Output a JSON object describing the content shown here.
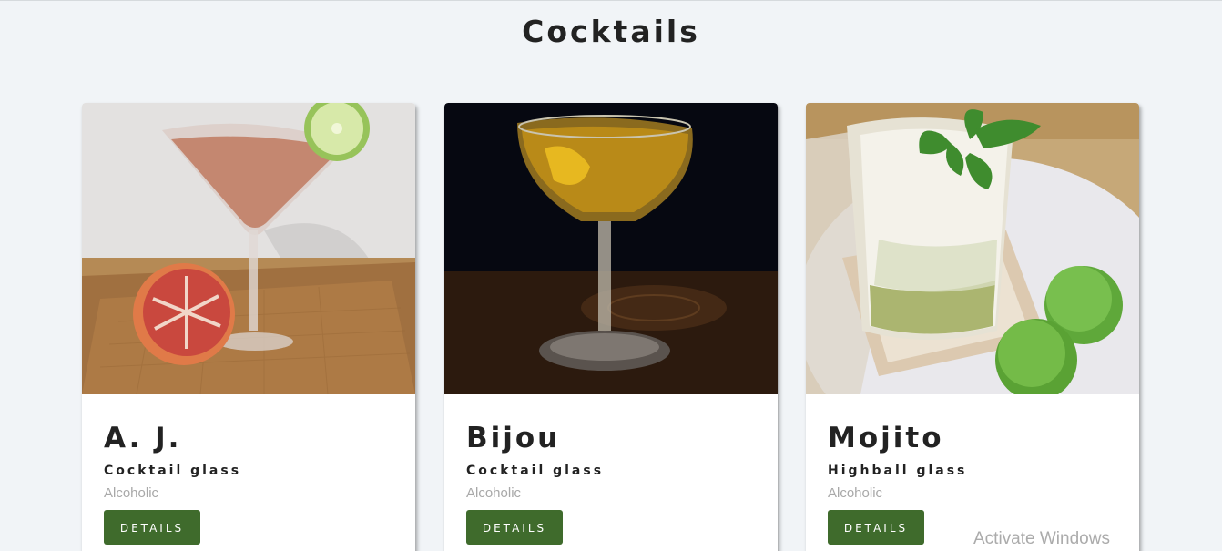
{
  "page": {
    "title": "Cocktails"
  },
  "cards": [
    {
      "name": "A. J.",
      "glass": "Cocktail glass",
      "type": "Alcoholic",
      "button_label": "DETAILS",
      "image": "pink cocktail in martini glass with lime wheel and grapefruit half on tray"
    },
    {
      "name": "Bijou",
      "glass": "Cocktail glass",
      "type": "Alcoholic",
      "button_label": "DETAILS",
      "image": "amber cocktail in coupe glass with lemon twist on dark background"
    },
    {
      "name": "Mojito",
      "glass": "Highball glass",
      "type": "Alcoholic",
      "button_label": "DETAILS",
      "image": "mojito with mint sprig and crushed ice, limes beside glass"
    }
  ],
  "overlay": {
    "watermark": "Activate Windows"
  },
  "colors": {
    "background": "#f1f4f7",
    "button": "#3f6b2c",
    "text": "#222222",
    "muted": "#a8a8a8"
  }
}
